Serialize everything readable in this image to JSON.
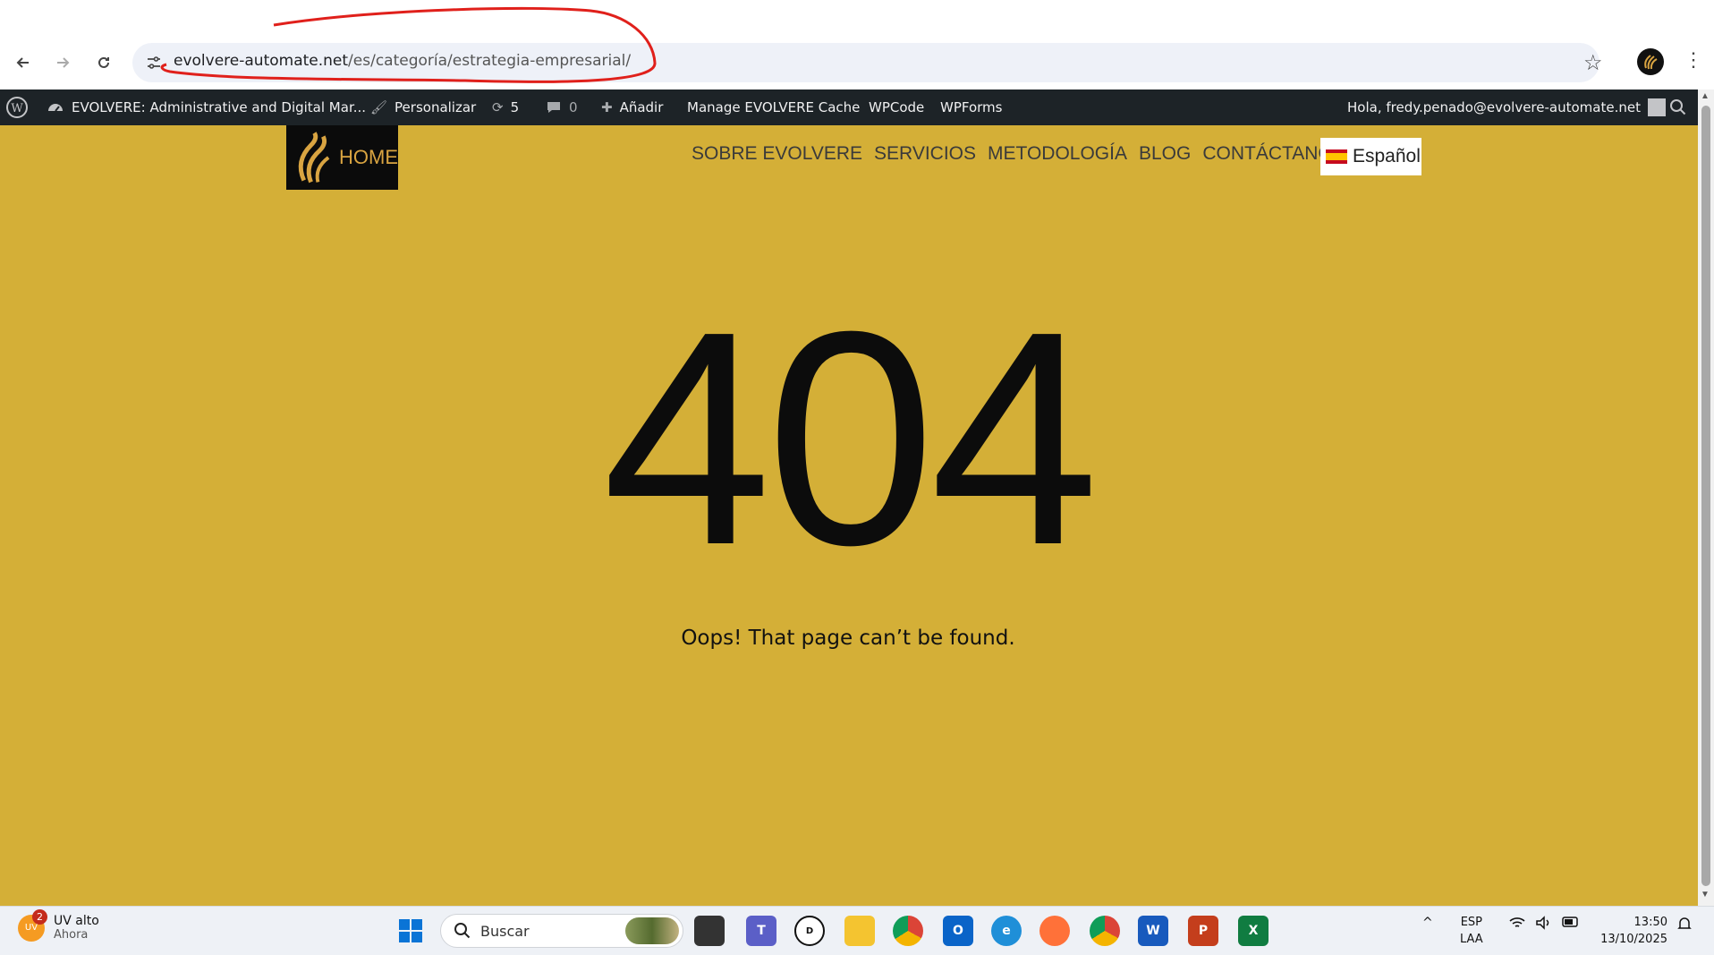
{
  "browser": {
    "url_domain": "evolvere-automate.net",
    "url_path": "/es/categoría/estrategia-empresarial/"
  },
  "admin_bar": {
    "site_name": "EVOLVERE: Administrative and Digital Mar...",
    "customize": "Personalizar",
    "updates_count": "5",
    "comments_count": "0",
    "new": "Añadir",
    "cache": "Manage EVOLVERE Cache",
    "wpcode": "WPCode",
    "wpforms": "WPForms",
    "greeting": "Hola, fredy.penado@evolvere-automate.net"
  },
  "site": {
    "logo_text": "HOME",
    "nav": [
      "SOBRE EVOLVERE",
      "SERVICIOS",
      "METODOLOGÍA",
      "BLOG",
      "CONTÁCTANOS"
    ],
    "language": "Español"
  },
  "error": {
    "code": "404",
    "message": "Oops! That page can’t be found."
  },
  "taskbar": {
    "widget_title": "UV alto",
    "widget_sub": "Ahora",
    "widget_badge": "2",
    "widget_icon_text": "UV",
    "search_placeholder": "Buscar",
    "lang_1": "ESP",
    "lang_2": "LAA",
    "time": "13:50",
    "date": "13/10/2025"
  },
  "colors": {
    "page_bg": "#d4af37",
    "admin_bar_bg": "#1d2327",
    "annotation_red": "#e0201b"
  }
}
